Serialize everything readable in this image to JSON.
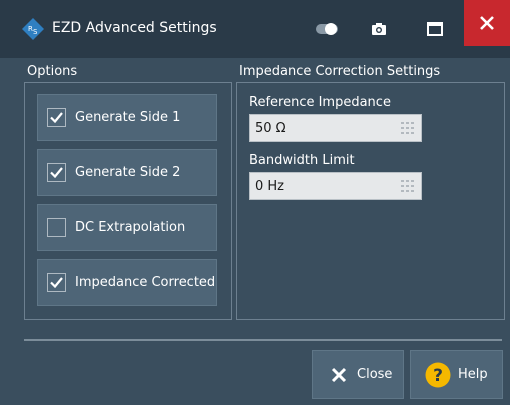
{
  "window": {
    "title": "EZD Advanced Settings",
    "accent_color": "#c8282e",
    "logo_color": "#2f7fc1"
  },
  "options": {
    "label": "Options",
    "items": [
      {
        "label": "Generate Side 1",
        "checked": true
      },
      {
        "label": "Generate Side 2",
        "checked": true
      },
      {
        "label": "DC Extrapolation",
        "checked": false
      },
      {
        "label": "Impedance Corrected",
        "checked": true
      }
    ]
  },
  "impedance": {
    "label": "Impedance Correction Settings",
    "reference_label": "Reference Impedance",
    "reference_value": "50 Ω",
    "bandwidth_label": "Bandwidth Limit",
    "bandwidth_value": "0 Hz"
  },
  "footer": {
    "close_label": "Close",
    "help_label": "Help",
    "help_icon_color": "#f5b800"
  }
}
